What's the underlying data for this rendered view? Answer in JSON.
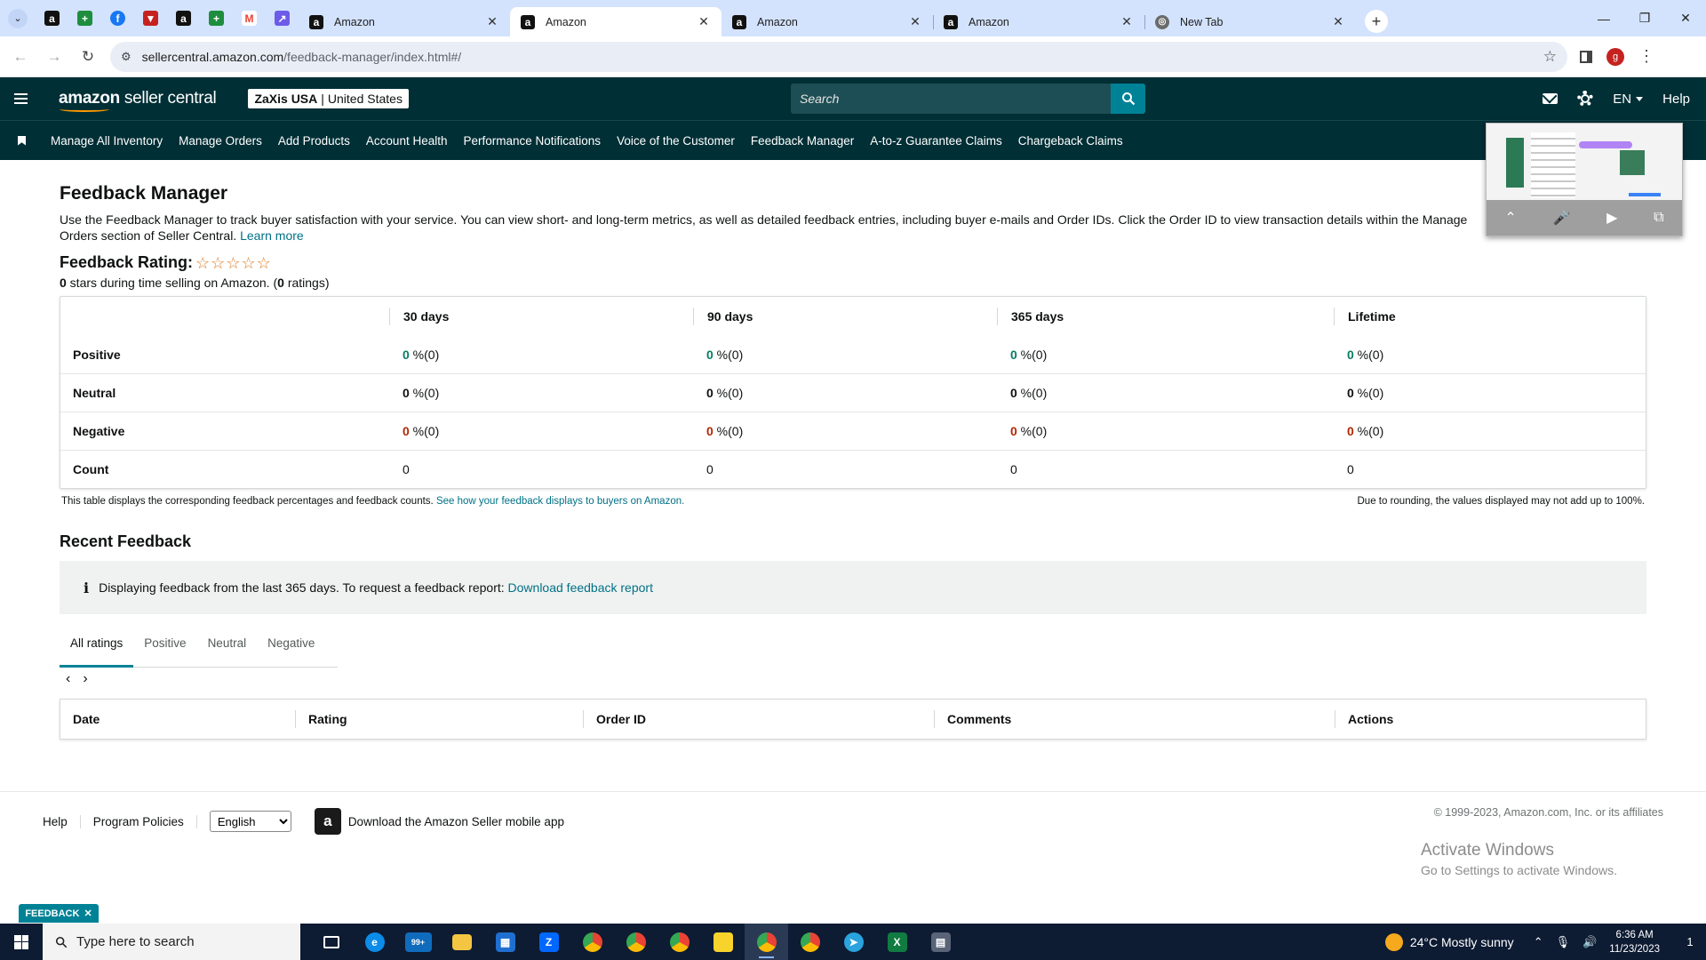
{
  "browser": {
    "tabs": [
      {
        "title": "Amazon",
        "active": false
      },
      {
        "title": "Amazon",
        "active": true
      },
      {
        "title": "Amazon",
        "active": false
      },
      {
        "title": "Amazon",
        "active": false
      },
      {
        "title": "New Tab",
        "active": false
      }
    ],
    "pinned_icons": [
      "amazon-icon",
      "sheets-icon",
      "facebook-icon",
      "shield-icon",
      "amazon-icon",
      "sheets-icon",
      "gmail-icon",
      "arrow-icon"
    ],
    "url_host": "sellercentral.amazon.com",
    "url_path": "/feedback-manager/index.html#/",
    "profile_letter": "g"
  },
  "header": {
    "logo_bold": "amazon",
    "logo_rest": " seller central",
    "account_name": "ZaXis USA",
    "account_region": "United States",
    "search_placeholder": "Search",
    "language": "EN",
    "help": "Help"
  },
  "nav": {
    "items": [
      "Manage All Inventory",
      "Manage Orders",
      "Add Products",
      "Account Health",
      "Performance Notifications",
      "Voice of the Customer",
      "Feedback Manager",
      "A-to-z Guarantee Claims",
      "Chargeback Claims"
    ]
  },
  "page": {
    "title": "Feedback Manager",
    "description": "Use the Feedback Manager to track buyer satisfaction with your service. You can view short- and long-term metrics, as well as detailed feedback entries, including buyer e-mails and Order IDs. Click the Order ID to view transaction details within the Manage Orders section of Seller Central.",
    "learn_more": "Learn more",
    "rating_label": "Feedback Rating:",
    "stars_count": 0,
    "stars_text_pre": "0",
    "stars_text_mid": " stars during time selling on Amazon. (",
    "ratings_count": "0",
    "stars_text_post": " ratings)"
  },
  "metrics": {
    "columns": [
      "",
      "30 days",
      "90 days",
      "365 days",
      "Lifetime"
    ],
    "rows": [
      {
        "label": "Positive",
        "values": [
          "0",
          "0",
          "0",
          "0"
        ],
        "suffix": " %(0)",
        "tone": "pos"
      },
      {
        "label": "Neutral",
        "values": [
          "0",
          "0",
          "0",
          "0"
        ],
        "suffix": " %(0)",
        "tone": "neu"
      },
      {
        "label": "Negative",
        "values": [
          "0",
          "0",
          "0",
          "0"
        ],
        "suffix": " %(0)",
        "tone": "neg"
      },
      {
        "label": "Count",
        "values": [
          "0",
          "0",
          "0",
          "0"
        ],
        "suffix": "",
        "tone": "plain"
      }
    ],
    "note_left": "This table displays the corresponding feedback percentages and feedback counts.",
    "note_link": "See how your feedback displays to buyers on Amazon.",
    "note_right": "Due to rounding, the values displayed may not add up to 100%."
  },
  "recent": {
    "title": "Recent Feedback",
    "alert_text": "Displaying feedback from the last 365 days. To request a feedback report:",
    "alert_link": "Download feedback report",
    "tabs": [
      "All ratings",
      "Positive",
      "Neutral",
      "Negative"
    ],
    "active_tab": 0,
    "columns": [
      "Date",
      "Rating",
      "Order ID",
      "Comments",
      "Actions"
    ]
  },
  "footer": {
    "help": "Help",
    "policies": "Program Policies",
    "language_selected": "English",
    "app_text": "Download the Amazon Seller mobile app",
    "copyright": "© 1999-2023, Amazon.com, Inc. or its affiliates",
    "activate_title": "Activate Windows",
    "activate_sub": "Go to Settings to activate Windows.",
    "feedback_btn": "FEEDBACK"
  },
  "taskbar": {
    "search_placeholder": "Type here to search",
    "mail_badge": "99+",
    "weather": "24°C  Mostly sunny",
    "time": "6:36 AM",
    "date": "11/23/2023",
    "notifications": "1"
  },
  "colors": {
    "header_bg": "#002f36",
    "accent": "#008296",
    "link": "#007185",
    "positive": "#067d62",
    "negative": "#b12704",
    "star": "#de7921"
  }
}
